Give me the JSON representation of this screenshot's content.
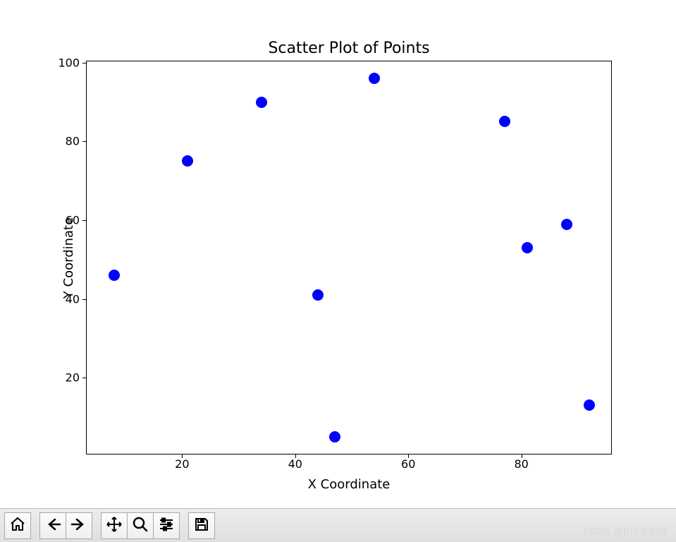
{
  "chart_data": {
    "type": "scatter",
    "title": "Scatter Plot of Points",
    "xlabel": "X Coordinate",
    "ylabel": "Y Coordinate",
    "color": "#0000ff",
    "xlim": [
      3,
      96
    ],
    "ylim": [
      0.5,
      100.5
    ],
    "x_ticks": [
      20,
      40,
      60,
      80
    ],
    "y_ticks": [
      20,
      40,
      60,
      80,
      100
    ],
    "points": [
      {
        "x": 8,
        "y": 46
      },
      {
        "x": 21,
        "y": 75
      },
      {
        "x": 34,
        "y": 90
      },
      {
        "x": 44,
        "y": 41
      },
      {
        "x": 47,
        "y": 5
      },
      {
        "x": 54,
        "y": 96
      },
      {
        "x": 77,
        "y": 85
      },
      {
        "x": 81,
        "y": 53
      },
      {
        "x": 88,
        "y": 59
      },
      {
        "x": 92,
        "y": 13
      }
    ]
  },
  "toolbar": {
    "home": "Home",
    "back": "Back",
    "forward": "Forward",
    "pan": "Pan",
    "zoom": "Zoom",
    "configure": "Configure subplots",
    "save": "Save"
  },
  "watermark": "CSDN @BIT龙超越"
}
